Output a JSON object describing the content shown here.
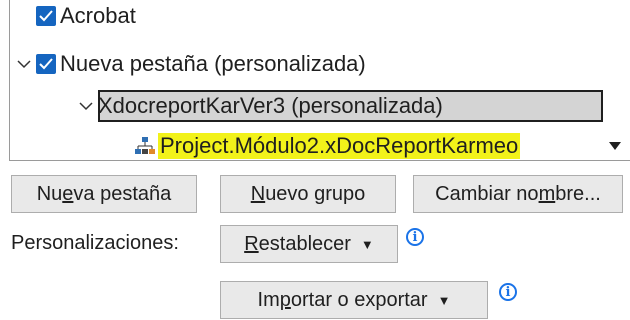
{
  "tree": {
    "items": [
      {
        "label": "Acrobat",
        "checked": true
      },
      {
        "label": "Nueva pestaña (personalizada)",
        "checked": true,
        "expanded": true
      },
      {
        "label": "XdocreportKarVer3 (personalizada)",
        "expanded": true
      },
      {
        "label": "Project.Módulo2.xDocReportKarmeo",
        "icon": "macro-tree-icon"
      }
    ]
  },
  "buttons": {
    "new_tab": {
      "pre": "Nu",
      "key": "e",
      "post": "va pestaña"
    },
    "new_group": {
      "pre": "",
      "key": "N",
      "post": "uevo grupo"
    },
    "rename": {
      "pre": "Cambiar no",
      "key": "m",
      "post": "bre..."
    },
    "reset": {
      "pre": "",
      "key": "R",
      "post": "establecer"
    },
    "import_export": {
      "pre": "Im",
      "key": "p",
      "post": "ortar o exportar"
    }
  },
  "customizations_label": "Personalizaciones:",
  "colors": {
    "accent": "#1565c0",
    "highlight": "#f2f21a",
    "info": "#1a73e8"
  }
}
